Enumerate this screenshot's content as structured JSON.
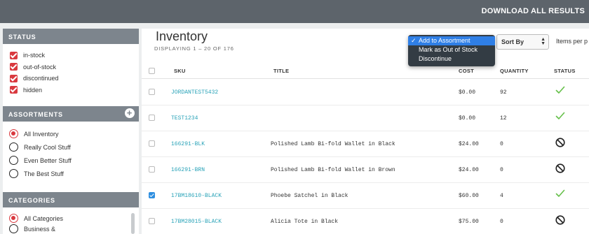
{
  "topbar": {
    "download_label": "DOWNLOAD ALL RESULTS"
  },
  "sidebar": {
    "status_header": "STATUS",
    "status_items": [
      {
        "label": "in-stock",
        "checked": true
      },
      {
        "label": "out-of-stock",
        "checked": true
      },
      {
        "label": "discontinued",
        "checked": true
      },
      {
        "label": "hidden",
        "checked": true
      }
    ],
    "assortments_header": "ASSORTMENTS",
    "add_icon": "plus-icon",
    "assortments": [
      {
        "label": "All Inventory",
        "selected": true
      },
      {
        "label": "Really Cool Stuff",
        "selected": false
      },
      {
        "label": "Even Better Stuff",
        "selected": false
      },
      {
        "label": "The Best Stuff",
        "selected": false
      }
    ],
    "categories_header": "CATEGORIES",
    "categories": [
      {
        "label": "All Categories",
        "selected": true
      },
      {
        "label": "Business &",
        "selected": false
      }
    ]
  },
  "main": {
    "title": "Inventory",
    "subtitle": "DISPLAYING 1 – 20 OF 176",
    "sort_label": "Sort By",
    "per_page_label": "Items per p",
    "columns": {
      "sku": "SKU",
      "title": "TITLE",
      "cost": "COST",
      "quantity": "QUANTITY",
      "status": "STATUS"
    },
    "rows": [
      {
        "checked": false,
        "sku": "JORDANTEST5432",
        "title": "",
        "cost": "$0.00",
        "quantity": "92",
        "status": "check-icon"
      },
      {
        "checked": false,
        "sku": "TEST1234",
        "title": "",
        "cost": "$0.00",
        "quantity": "12",
        "status": "check-icon"
      },
      {
        "checked": false,
        "sku": "166291-BLK",
        "title": "Polished Lamb Bi-fold Wallet in Black",
        "cost": "$24.00",
        "quantity": "0",
        "status": "prohibited-icon"
      },
      {
        "checked": false,
        "sku": "166291-BRN",
        "title": "Polished Lamb Bi-fold Wallet in Brown",
        "cost": "$24.00",
        "quantity": "0",
        "status": "prohibited-icon"
      },
      {
        "checked": true,
        "sku": "17BM18610-BLACK",
        "title": "Phoebe Satchel in Black",
        "cost": "$60.00",
        "quantity": "4",
        "status": "check-icon"
      },
      {
        "checked": false,
        "sku": "17BM28015-BLACK",
        "title": "Alicia Tote in Black",
        "cost": "$75.00",
        "quantity": "0",
        "status": "prohibited-icon"
      }
    ]
  },
  "action_menu": {
    "items": [
      {
        "label": "Add to Assortment",
        "active": true
      },
      {
        "label": "Mark as Out of Stock",
        "active": false
      },
      {
        "label": "Discontinue",
        "active": false
      }
    ]
  },
  "colors": {
    "topbar": "#5d646b",
    "section_header": "#7d858d",
    "accent_red": "#d9393f",
    "sku_link": "#2aa3b8",
    "check_green": "#66c04a",
    "menu_bg": "#333c44",
    "menu_active": "#2f7fe6"
  }
}
